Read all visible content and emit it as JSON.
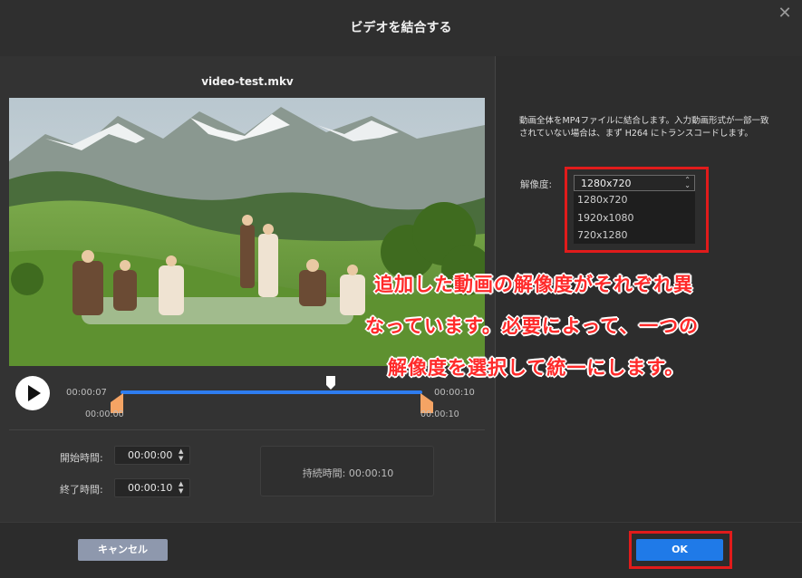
{
  "dialog": {
    "title": "ビデオを結合する"
  },
  "preview": {
    "filename": "video-test.mkv",
    "current_time": "00:00:07",
    "end_time_label": "00:00:10",
    "range_start": "00:00:00",
    "range_end": "00:00:10"
  },
  "trim": {
    "start_label": "開始時間:",
    "start_value": "00:00:00",
    "end_label": "終了時間:",
    "end_value": "00:00:10",
    "duration_label": "持続時間:",
    "duration_value": "00:00:10"
  },
  "settings": {
    "description": "動画全体をMP4ファイルに結合します。入力動画形式が一部一致されていない場合は、まず H264 にトランスコードします。",
    "resolution_label": "解像度:",
    "resolution_selected": "1280x720",
    "resolution_options": [
      "1280x720",
      "1920x1080",
      "720x1280"
    ]
  },
  "annotation": {
    "line1": "追加した動画の解像度がそれぞれ異",
    "line2": "なっています。必要によって、一つの",
    "line3": "解像度を選択して統一にします。"
  },
  "buttons": {
    "cancel": "キャンセル",
    "ok": "OK"
  },
  "colors": {
    "accent": "#1f7ae8",
    "annotation_red": "#e11b1b",
    "timeline_handle": "#f5a464"
  }
}
